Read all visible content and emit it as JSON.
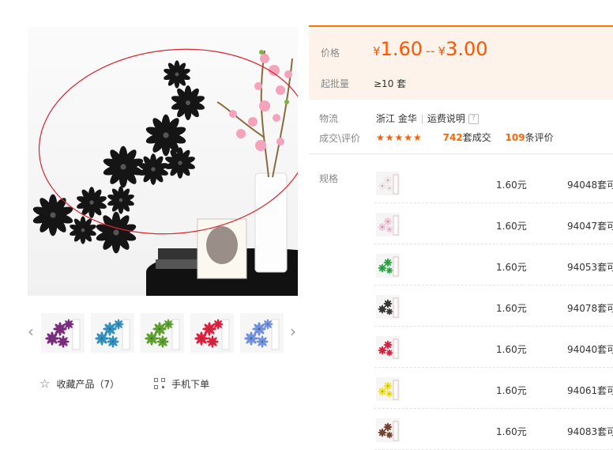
{
  "gallery": {
    "thumbnails": [
      {
        "name": "thumb-purple",
        "color": "#7a2a7e"
      },
      {
        "name": "thumb-blue",
        "color": "#2f8fbf"
      },
      {
        "name": "thumb-green",
        "color": "#5aa02a"
      },
      {
        "name": "thumb-red",
        "color": "#e01e3c"
      },
      {
        "name": "thumb-lightblue",
        "color": "#6f8fe0"
      }
    ]
  },
  "actions": {
    "favorite_label": "收藏产品（7）",
    "mobile_label": "手机下单"
  },
  "price": {
    "label": "价格",
    "currency": "¥",
    "min": "1.60",
    "dash": "--",
    "max": "3.00"
  },
  "moq": {
    "label": "起批量",
    "value": "≥10 套"
  },
  "logistics": {
    "label": "物流",
    "location": "浙江 金华",
    "shipping": "运费说明",
    "help": "?"
  },
  "deals": {
    "label": "成交\\评价",
    "stars": "★★★★★",
    "count": "742",
    "count_unit": "套成交",
    "reviews": "109",
    "reviews_unit": "条评价"
  },
  "spec": {
    "label": "规格",
    "rows": [
      {
        "price": "1.60元",
        "stock": "94048套可",
        "color": "#f0e6e6"
      },
      {
        "price": "1.60元",
        "stock": "94047套可",
        "color": "#f2c6d8"
      },
      {
        "price": "1.60元",
        "stock": "94053套可",
        "color": "#2ea84a"
      },
      {
        "price": "1.60元",
        "stock": "94078套可",
        "color": "#333333"
      },
      {
        "price": "1.60元",
        "stock": "94040套可",
        "color": "#e0203e"
      },
      {
        "price": "1.60元",
        "stock": "94061套可",
        "color": "#f2e024"
      },
      {
        "price": "1.60元",
        "stock": "94083套可",
        "color": "#7a4030"
      }
    ]
  }
}
